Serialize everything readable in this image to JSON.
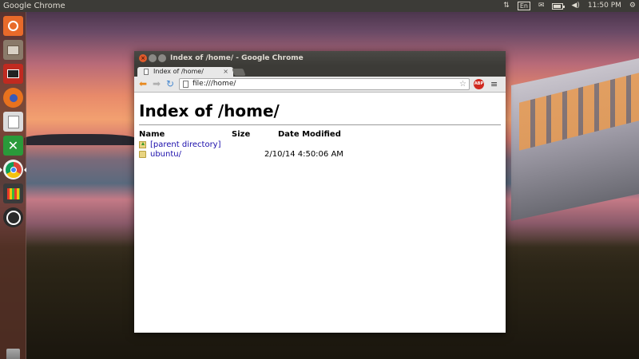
{
  "top_panel": {
    "app_title": "Google Chrome",
    "keyboard_layout": "En",
    "time": "11:50 PM"
  },
  "launcher": {
    "items": [
      {
        "name": "dash-home",
        "color": "#e86a2a"
      },
      {
        "name": "files",
        "color": "#8a7a6a"
      },
      {
        "name": "screenshot",
        "color": "#c02a20"
      },
      {
        "name": "firefox",
        "color": "#e8721e"
      },
      {
        "name": "text-editor",
        "color": "#dcdcdc"
      },
      {
        "name": "crossover",
        "color": "#2a9a3a"
      },
      {
        "name": "chrome",
        "color": "#4a8ad0",
        "active": true
      },
      {
        "name": "system-monitor",
        "color": "#3a3a3a"
      },
      {
        "name": "ubuntu-one",
        "color": "#2a2a2a"
      }
    ]
  },
  "window": {
    "title": "Index of /home/ - Google Chrome",
    "tab_label": "Index of /home/",
    "tab_close": "×",
    "url": "file:///home/",
    "abp_label": "ABP"
  },
  "page": {
    "heading": "Index of /home/",
    "columns": {
      "name": "Name",
      "size": "Size",
      "date": "Date Modified"
    },
    "rows": [
      {
        "name": "[parent directory]",
        "size": "",
        "date": "",
        "type": "up"
      },
      {
        "name": "ubuntu/",
        "size": "",
        "date": "2/10/14 4:50:06 AM",
        "type": "folder"
      }
    ]
  }
}
